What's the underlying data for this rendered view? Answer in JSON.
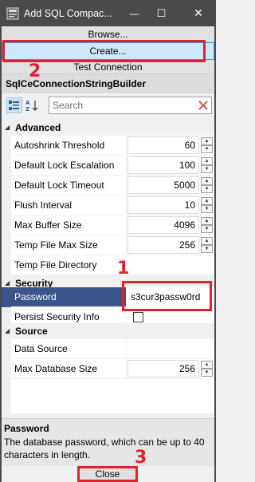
{
  "window": {
    "title": "Add SQL Compac...",
    "minimize_glyph": "—",
    "maximize_glyph": "☐",
    "close_glyph": "✕"
  },
  "buttons": {
    "browse": "Browse...",
    "create": "Create...",
    "test_connection": "Test Connection",
    "close": "Close"
  },
  "property_grid": {
    "object_name": "SqlCeConnectionStringBuilder",
    "search_placeholder": "Search",
    "categories": [
      {
        "name": "Advanced",
        "properties": [
          {
            "name": "Autoshrink Threshold",
            "value": "60"
          },
          {
            "name": "Default Lock Escalation",
            "value": "100"
          },
          {
            "name": "Default Lock Timeout",
            "value": "5000"
          },
          {
            "name": "Flush Interval",
            "value": "10"
          },
          {
            "name": "Max Buffer Size",
            "value": "4096"
          },
          {
            "name": "Temp File Max Size",
            "value": "256"
          },
          {
            "name": "Temp File Directory",
            "value": ""
          }
        ]
      },
      {
        "name": "Security",
        "properties": [
          {
            "name": "Password",
            "value": "s3cur3passw0rd"
          },
          {
            "name": "Persist Security Info",
            "value": false
          }
        ]
      },
      {
        "name": "Source",
        "properties": [
          {
            "name": "Data Source",
            "value": ""
          },
          {
            "name": "Max Database Size",
            "value": "256"
          }
        ]
      }
    ]
  },
  "description": {
    "title": "Password",
    "text": "The database password, which can be up to 40 characters in length."
  },
  "annotations": {
    "step1": "1",
    "step2": "2",
    "step3": "3",
    "color": "#e0222c"
  }
}
